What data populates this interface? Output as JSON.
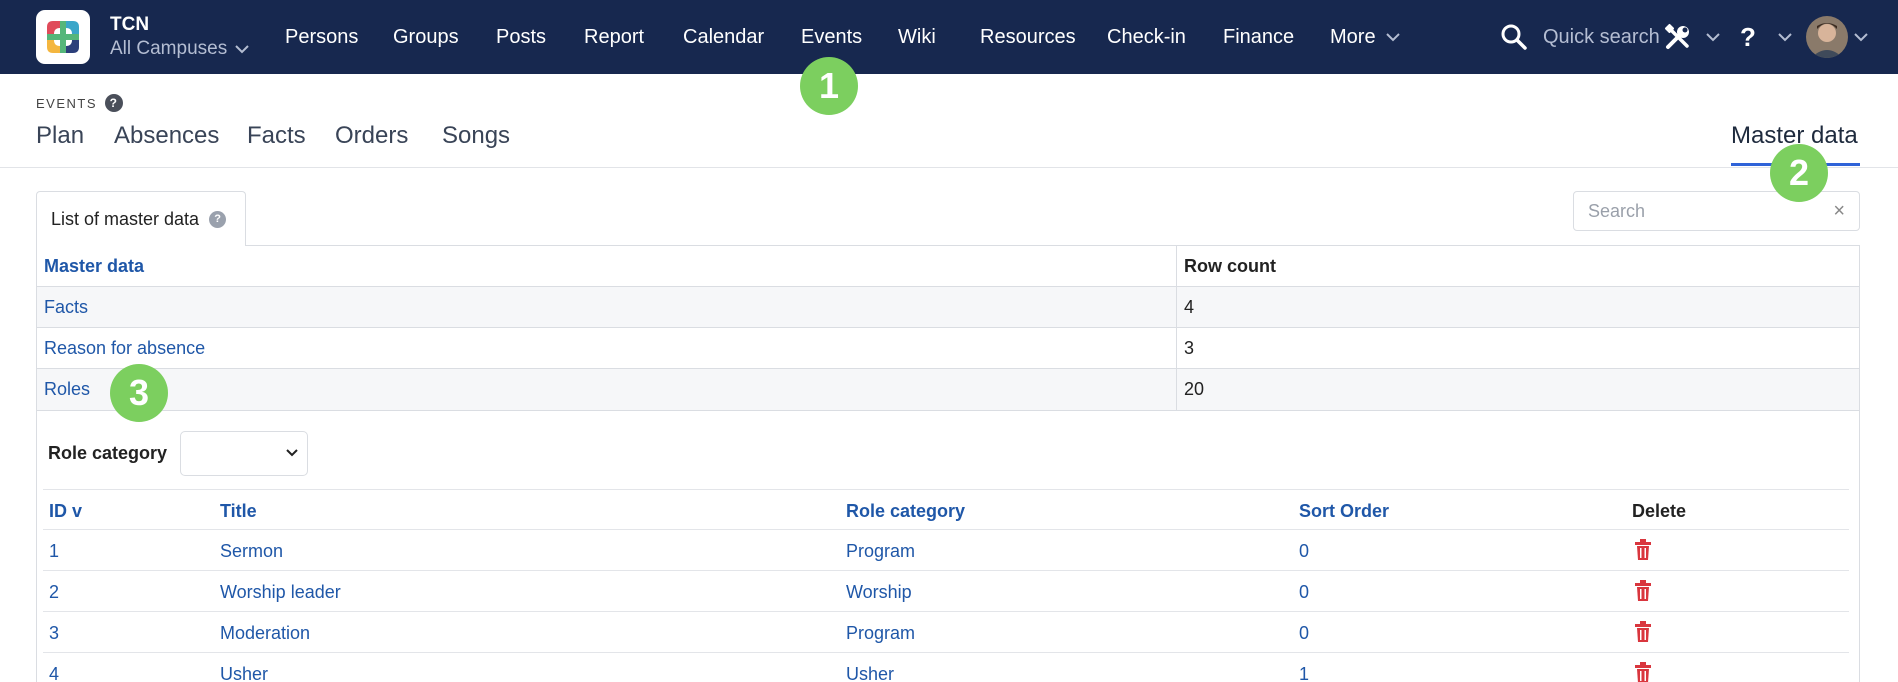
{
  "header": {
    "org_name": "TCN",
    "campus": "All Campuses",
    "nav": [
      "Persons",
      "Groups",
      "Posts",
      "Report",
      "Calendar",
      "Events",
      "Wiki",
      "Resources",
      "Check-in",
      "Finance"
    ],
    "more_label": "More",
    "quick_search_label": "Quick search",
    "help_label": "?",
    "icons": {
      "search": "search-icon",
      "tools": "tools-icon",
      "help": "help-icon",
      "avatar": "user-avatar"
    }
  },
  "section": {
    "label": "EVENTS",
    "help": "?",
    "tabs": [
      "Plan",
      "Absences",
      "Facts",
      "Orders",
      "Songs"
    ],
    "right_tab": "Master data",
    "active_tab": "Master data"
  },
  "panel": {
    "tab_label": "List of master data",
    "tab_help": "?",
    "search_placeholder": "Search",
    "search_clear": "×"
  },
  "master_table": {
    "headers": [
      "Master data",
      "Row count"
    ],
    "rows": [
      {
        "name": "Facts",
        "count": "4"
      },
      {
        "name": "Reason for absence",
        "count": "3"
      },
      {
        "name": "Roles",
        "count": "20"
      }
    ]
  },
  "roles": {
    "filter_label": "Role category",
    "filter_value": "",
    "headers": {
      "id": "ID v",
      "title": "Title",
      "category": "Role category",
      "sort": "Sort Order",
      "delete": "Delete"
    },
    "rows": [
      {
        "id": "1",
        "title": "Sermon",
        "category": "Program",
        "sort": "0"
      },
      {
        "id": "2",
        "title": "Worship leader",
        "category": "Worship",
        "sort": "0"
      },
      {
        "id": "3",
        "title": "Moderation",
        "category": "Program",
        "sort": "0"
      },
      {
        "id": "4",
        "title": "Usher",
        "category": "Usher",
        "sort": "1"
      }
    ]
  },
  "markers": [
    "1",
    "2",
    "3"
  ],
  "colors": {
    "nav_bg": "#17284f",
    "link": "#1f57a8",
    "marker": "#7ccf5f",
    "delete": "#d9363e",
    "active_underline": "#2f63d8"
  }
}
